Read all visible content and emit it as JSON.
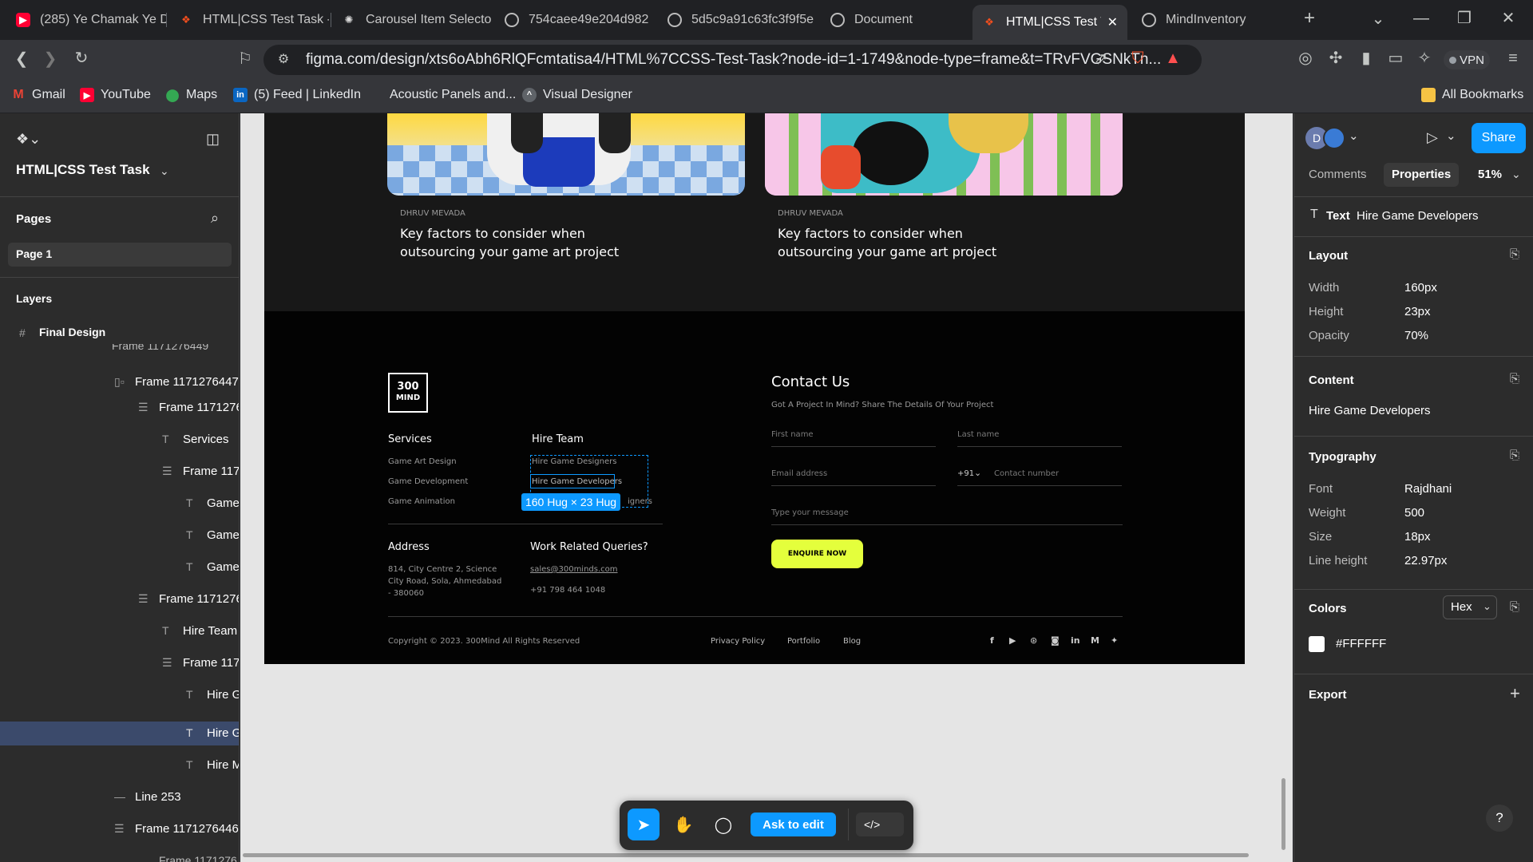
{
  "browser": {
    "tabs": [
      {
        "label": "(285) Ye Chamak Ye D"
      },
      {
        "label": "HTML|CSS Test Task -"
      },
      {
        "label": "Carousel Item Selecto"
      },
      {
        "label": "754caee49e204d982"
      },
      {
        "label": "5d5c9a91c63fc3f9f5e"
      },
      {
        "label": "Document"
      },
      {
        "label": "HTML|CSS Test T"
      },
      {
        "label": "MindInventory"
      }
    ],
    "url": "figma.com/design/xts6oAbh6RlQFcmtatisa4/HTML%7CCSS-Test-Task?node-id=1-1749&node-type=frame&t=TRvFVGSNkTn...",
    "vpn_label": "VPN",
    "bookmarks": [
      "Gmail",
      "YouTube",
      "Maps",
      "(5) Feed | LinkedIn",
      "Acoustic Panels and...",
      "Visual Designer"
    ],
    "all_bookmarks": "All Bookmarks"
  },
  "figma": {
    "file_title": "HTML|CSS Test Task",
    "pages_label": "Pages",
    "page1": "Page 1",
    "layers_label": "Layers",
    "final_design": "Final Design",
    "layers": [
      {
        "label": "Frame 1171276449"
      },
      {
        "label": "Frame 1171276447"
      },
      {
        "label": "Frame 1171276"
      },
      {
        "label": "Services"
      },
      {
        "label": "Frame 1171"
      },
      {
        "label": "Game"
      },
      {
        "label": "Game"
      },
      {
        "label": "Game"
      },
      {
        "label": "Frame 1171276"
      },
      {
        "label": "Hire Team"
      },
      {
        "label": "Frame 1171"
      },
      {
        "label": "Hire G"
      },
      {
        "label": "Hire G"
      },
      {
        "label": "Hire M"
      },
      {
        "label": "Line 253"
      },
      {
        "label": "Frame 1171276446"
      },
      {
        "label": "Frame 1171276"
      }
    ],
    "ask_to_edit": "Ask to edit"
  },
  "design": {
    "cards": [
      {
        "author": "DHRUV MEVADA",
        "title_line1": "Key factors to consider when",
        "title_line2": "outsourcing your game art project"
      },
      {
        "author": "DHRUV MEVADA",
        "title_line1": "Key factors to consider when",
        "title_line2": "outsourcing your game art project"
      }
    ],
    "logo_text_1": "300",
    "logo_text_2": "MIND",
    "services_heading": "Services",
    "services": [
      "Game Art Design",
      "Game Development",
      "Game Animation"
    ],
    "hire_heading": "Hire Team",
    "hire": [
      "Hire Game Designers",
      "Hire Game Developers",
      "Hire Game Designers"
    ],
    "hire_partial": "igners",
    "selection_badge": "160 Hug × 23 Hug",
    "address_heading": "Address",
    "address_lines": [
      "814, City Centre 2, Science",
      "City Road, Sola, Ahmedabad",
      "- 380060"
    ],
    "queries_heading": "Work Related Queries?",
    "email": "sales@300minds.com",
    "phone": "+91 798 464 1048",
    "contact_heading": "Contact Us",
    "contact_sub": "Got A Project In Mind? Share The Details Of Your Project",
    "first_name": "First name",
    "last_name": "Last name",
    "email_address": "Email address",
    "country_code": "+91",
    "contact_number": "Contact number",
    "message": "Type your message",
    "enquire": "ENQUIRE NOW",
    "copyright": "Copyright © 2023. 300Mind All Rights Reserved",
    "footer_links": [
      "Privacy Policy",
      "Portfolio",
      "Blog"
    ],
    "social": [
      "facebook-icon",
      "youtube-icon",
      "dribbble-icon",
      "instagram-icon",
      "linkedin-icon",
      "medium-icon",
      "twitter-icon"
    ]
  },
  "props": {
    "comments_tab": "Comments",
    "properties_tab": "Properties",
    "zoom": "51%",
    "share": "Share",
    "node_type": "Text",
    "node_name": "Hire Game Developers",
    "layout_heading": "Layout",
    "width_label": "Width",
    "width_value": "160px",
    "height_label": "Height",
    "height_value": "23px",
    "opacity_label": "Opacity",
    "opacity_value": "70%",
    "content_heading": "Content",
    "content_value": "Hire Game Developers",
    "typography_heading": "Typography",
    "font_label": "Font",
    "font_value": "Rajdhani",
    "weight_label": "Weight",
    "weight_value": "500",
    "size_label": "Size",
    "size_value": "18px",
    "lineheight_label": "Line height",
    "lineheight_value": "22.97px",
    "colors_heading": "Colors",
    "color_format": "Hex",
    "color_value": "#FFFFFF",
    "export_heading": "Export"
  },
  "colors": {
    "accent": "#0d99ff",
    "enquire": "#e4ff3c",
    "selected_layer": "#3b4a6b"
  }
}
